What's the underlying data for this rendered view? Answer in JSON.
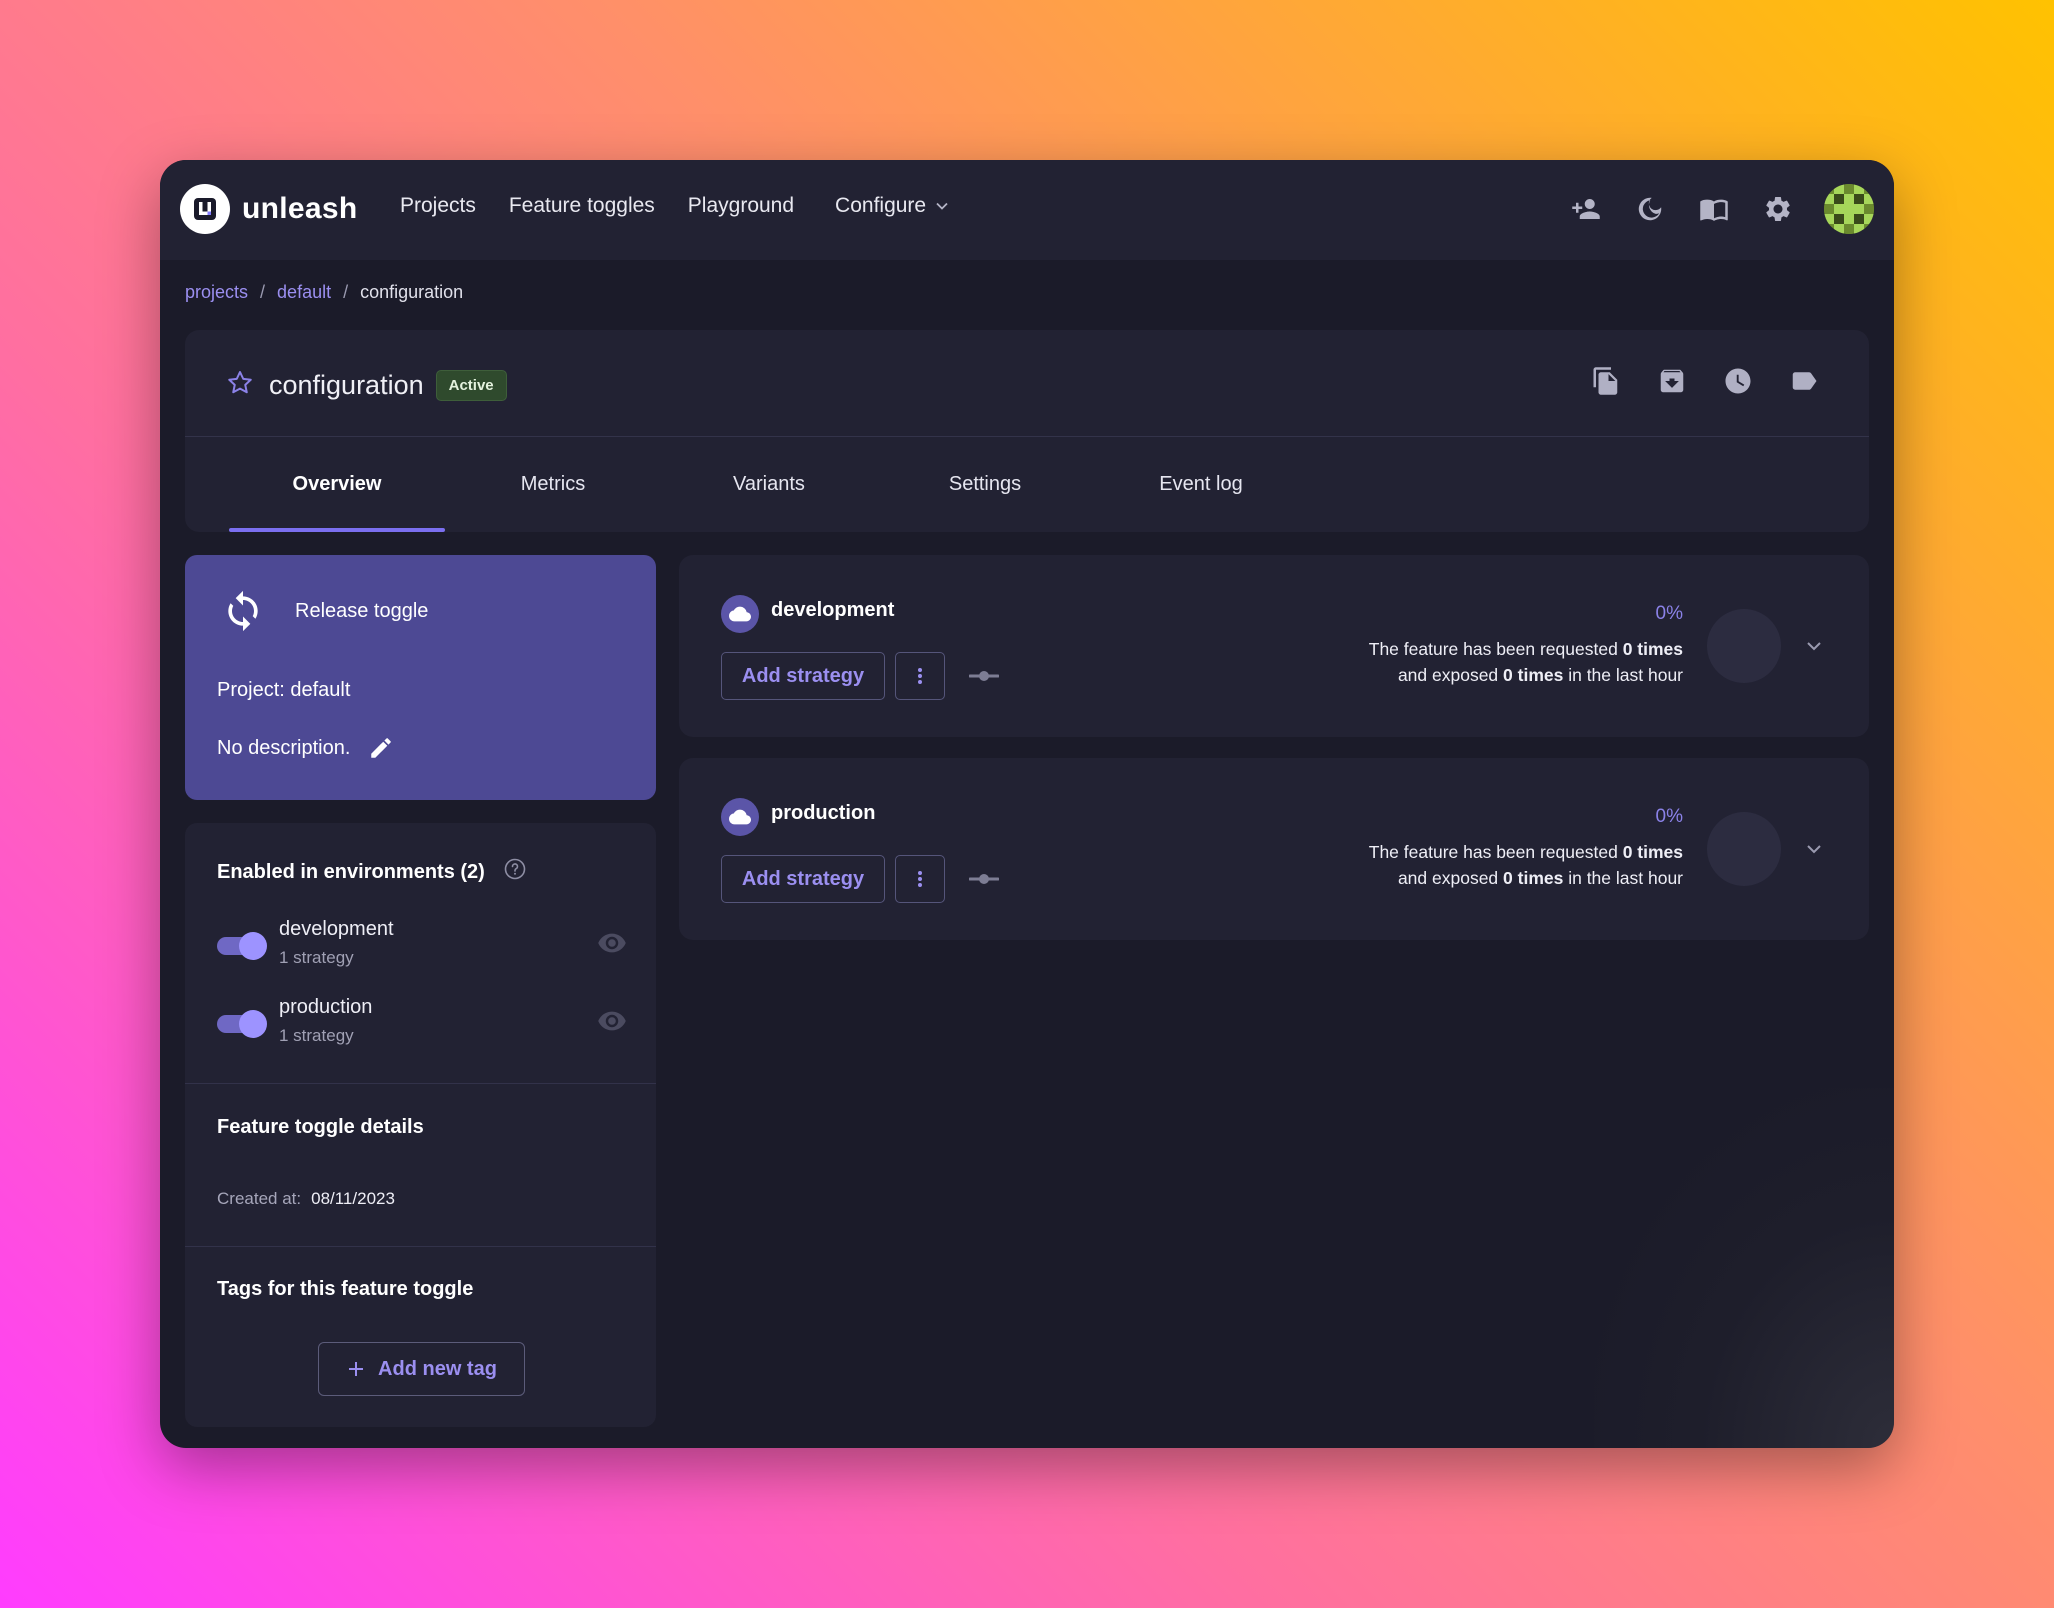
{
  "app": {
    "brand": "unleash"
  },
  "nav": {
    "links": [
      "Projects",
      "Feature toggles",
      "Playground"
    ],
    "configure": "Configure",
    "icons": [
      "invite-user-icon",
      "dark-mode-icon",
      "docs-icon",
      "settings-icon",
      "avatar"
    ]
  },
  "breadcrumb": {
    "projects": "projects",
    "default": "default",
    "current": "configuration",
    "separator": "/"
  },
  "feature": {
    "name": "configuration",
    "status": "Active",
    "actions": [
      "copy-icon",
      "archive-icon",
      "history-icon",
      "tag-icon"
    ]
  },
  "tabs": [
    "Overview",
    "Metrics",
    "Variants",
    "Settings",
    "Event log"
  ],
  "release": {
    "type": "Release toggle",
    "project": "Project: default",
    "description": "No description."
  },
  "environments_panel": {
    "heading": "Enabled in environments (2)",
    "items": [
      {
        "name": "development",
        "strategies": "1 strategy",
        "enabled": true
      },
      {
        "name": "production",
        "strategies": "1 strategy",
        "enabled": true
      }
    ]
  },
  "details": {
    "heading": "Feature toggle details",
    "created_label": "Created at:",
    "created_value": "08/11/2023"
  },
  "tags": {
    "heading": "Tags for this feature toggle",
    "add_label": "Add new tag"
  },
  "env_cards": [
    {
      "name": "development",
      "add_strategy": "Add strategy",
      "percent": "0%",
      "req_prefix": "The feature has been requested ",
      "req_count": "0 times",
      "exp_prefix": "and exposed ",
      "exp_count": "0 times",
      "exp_suffix": " in the last hour"
    },
    {
      "name": "production",
      "add_strategy": "Add strategy",
      "percent": "0%",
      "req_prefix": "The feature has been requested ",
      "req_count": "0 times",
      "exp_prefix": "and exposed ",
      "exp_count": "0 times",
      "exp_suffix": " in the last hour"
    }
  ],
  "colors": {
    "accent": "#7b6ff0",
    "release_card": "#4d4994",
    "active_badge": "#2f4a2d",
    "surface": "#222233",
    "background": "#1b1b29"
  }
}
